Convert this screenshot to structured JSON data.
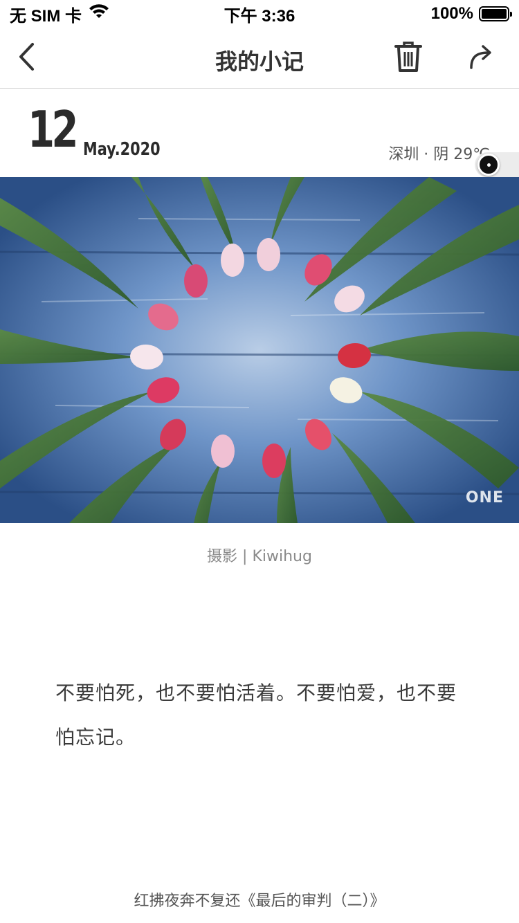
{
  "status_bar": {
    "carrier": "无 SIM 卡",
    "time": "下午 3:36",
    "battery": "100%",
    "battery_level": 1.0
  },
  "nav": {
    "title": "我的小记",
    "icons": [
      "chevron-left-icon",
      "trash-icon",
      "share-icon"
    ]
  },
  "date": {
    "day": "12",
    "month_year": "May.2020",
    "weather": "深圳 · 阴 29℃"
  },
  "photo": {
    "watermark": "ONE",
    "credit": "摄影 | Kiwihug"
  },
  "quote": {
    "text": "不要怕死，也不要怕活着。不要怕爱，也不要怕忘记。"
  },
  "source": {
    "text": "红拂夜奔不复还《最后的审判（二）》"
  },
  "colors": {
    "title_text": "#333333",
    "divider": "#cfcfcf",
    "wood_blue": "#3f68a8",
    "leaf_green": "#3b6b34"
  }
}
